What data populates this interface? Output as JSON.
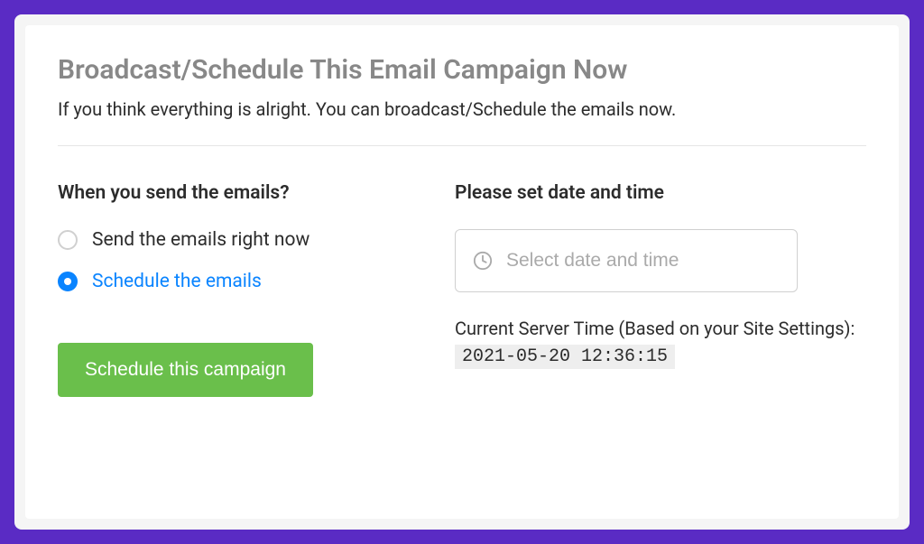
{
  "header": {
    "title": "Broadcast/Schedule This Email Campaign Now",
    "subtitle": "If you think everything is alright. You can broadcast/Schedule the emails now."
  },
  "sendTiming": {
    "heading": "When you send the emails?",
    "options": [
      {
        "label": "Send the emails right now",
        "selected": false
      },
      {
        "label": "Schedule the emails",
        "selected": true
      }
    ]
  },
  "datetime": {
    "heading": "Please set date and time",
    "placeholder": "Select date and time",
    "value": "",
    "serverTimeLabel": "Current Server Time (Based on your Site Settings):",
    "serverTimeValue": "2021-05-20 12:36:15"
  },
  "submit": {
    "label": "Schedule this campaign"
  }
}
